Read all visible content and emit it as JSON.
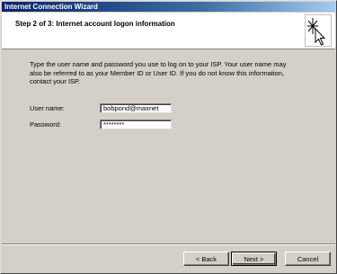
{
  "window": {
    "title": "Internet Connection Wizard"
  },
  "header": {
    "step_title": "Step 2 of 3: Internet account logon information"
  },
  "intro": "Type the user name and password you use to log on to your ISP. Your user name may also be referred to as your Member ID or User ID. If you do not know this information, contact your ISP.",
  "form": {
    "username_label": "User name:",
    "username_value": "bobpond@maxnet",
    "password_label": "Password:",
    "password_value": "********"
  },
  "buttons": {
    "back": "< Back",
    "next": "Next >",
    "cancel": "Cancel"
  },
  "icons": {
    "wizard": "wizard-cursor-sparkle-icon"
  }
}
